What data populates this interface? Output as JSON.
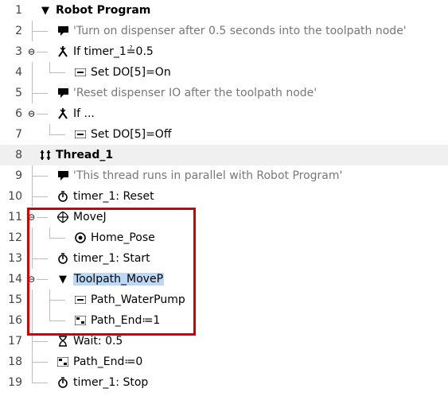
{
  "lines": {
    "l1": {
      "num": "1",
      "text": "Robot Program"
    },
    "l2": {
      "num": "2",
      "text": "'Turn on dispenser after 0.5 seconds into the toolpath node'"
    },
    "l3": {
      "num": "3",
      "text": "If timer_1≟0.5"
    },
    "l4": {
      "num": "4",
      "text": "Set DO[5]=On"
    },
    "l5": {
      "num": "5",
      "text": "'Reset dispenser IO after the toolpath node'"
    },
    "l6": {
      "num": "6",
      "text": "If ..."
    },
    "l7": {
      "num": "7",
      "text": "Set DO[5]=Off"
    },
    "l8": {
      "num": "8",
      "text": "Thread_1"
    },
    "l9": {
      "num": "9",
      "text": "'This thread runs in parallel with Robot Program'"
    },
    "l10": {
      "num": "10",
      "text": "timer_1: Reset"
    },
    "l11": {
      "num": "11",
      "text": "MoveJ"
    },
    "l12": {
      "num": "12",
      "text": "Home_Pose"
    },
    "l13": {
      "num": "13",
      "text": "timer_1: Start"
    },
    "l14": {
      "num": "14",
      "text": "Toolpath_MoveP"
    },
    "l15": {
      "num": "15",
      "text": "Path_WaterPump"
    },
    "l16": {
      "num": "16",
      "text": "Path_End≔1"
    },
    "l17": {
      "num": "17",
      "text": "Wait: 0.5"
    },
    "l18": {
      "num": "18",
      "text": "Path_End≔0"
    },
    "l19": {
      "num": "19",
      "text": "timer_1: Stop"
    }
  },
  "indent": {
    "d0": 14,
    "d1": 36,
    "d2": 58
  },
  "chart_data": null
}
